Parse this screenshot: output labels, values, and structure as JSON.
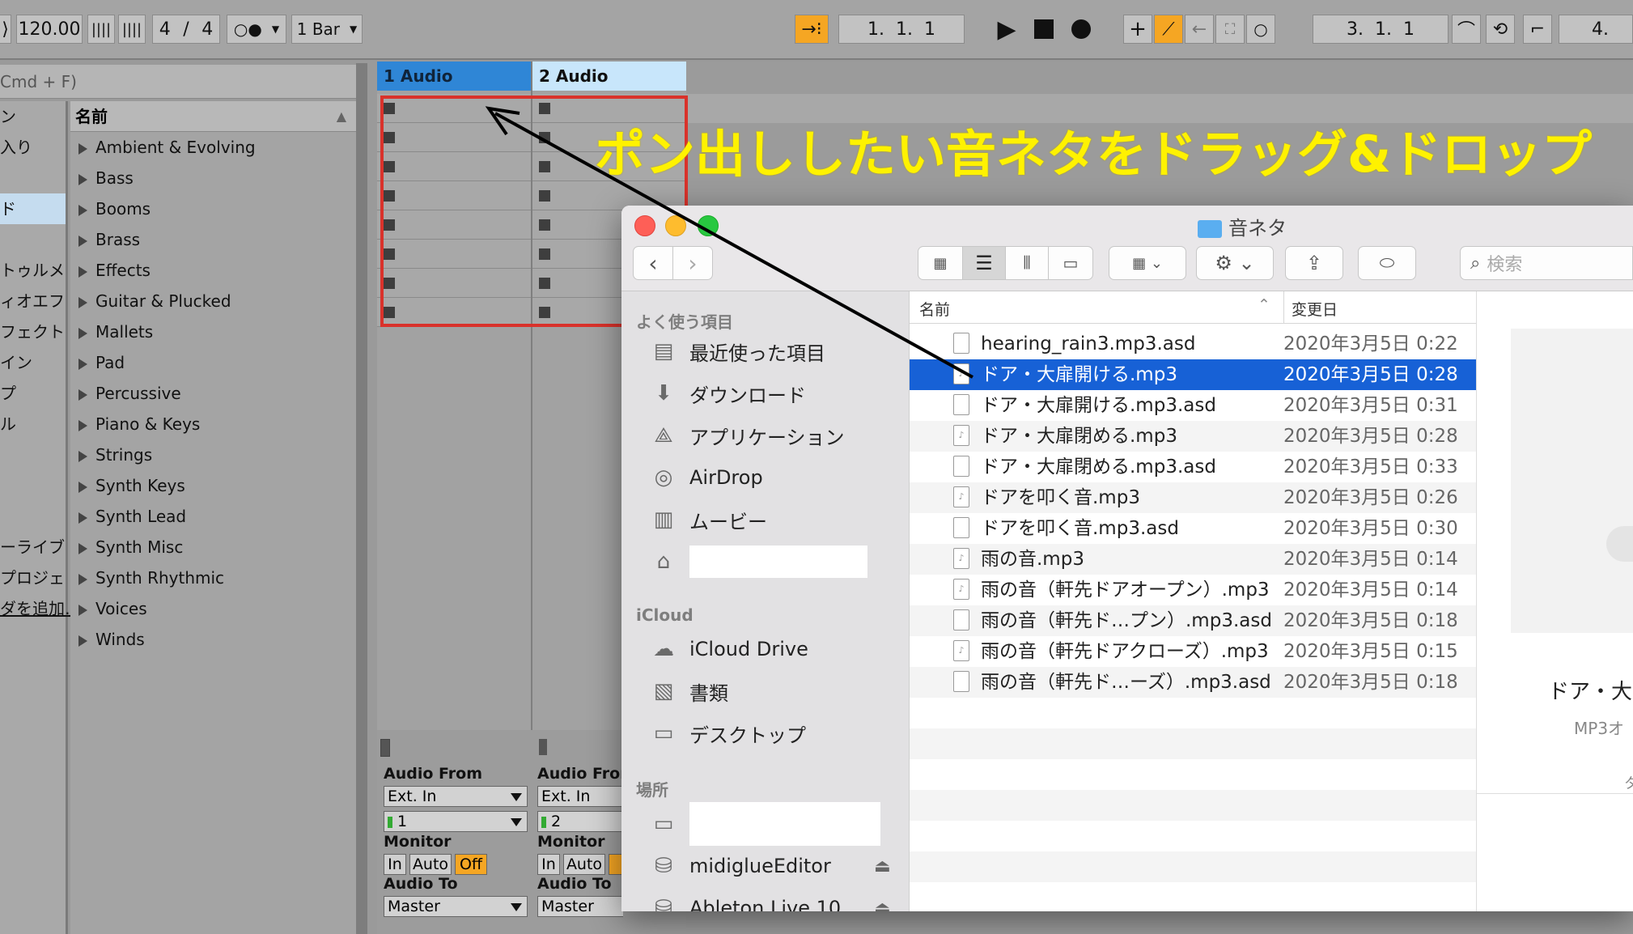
{
  "transport": {
    "tempo": "120.00",
    "time_sig_num": "4",
    "time_sig_sep": "/",
    "time_sig_den": "4",
    "quantize": "1 Bar",
    "metro": "○●",
    "arrangement_position": "1.  1.  1",
    "loop_start": "3.  1.  1",
    "loop_end_partial": "4."
  },
  "browser": {
    "search_hint": "Cmd + F)",
    "header": "名前",
    "places": [
      "ン",
      "入り",
      "",
      "ド",
      "",
      "トゥルメ",
      "ィオエフ",
      "フェクト",
      "イン",
      "プ",
      "ル",
      "",
      "",
      "",
      "ーライブ",
      "プロジェ",
      "ダを追加…"
    ],
    "categories": [
      "Ambient & Evolving",
      "Bass",
      "Booms",
      "Brass",
      "Effects",
      "Guitar & Plucked",
      "Mallets",
      "Pad",
      "Percussive",
      "Piano & Keys",
      "Strings",
      "Synth Keys",
      "Synth Lead",
      "Synth Misc",
      "Synth Rhythmic",
      "Voices",
      "Winds"
    ]
  },
  "tracks": [
    {
      "name": "1 Audio",
      "audio_from": "Audio From",
      "input": "Ext. In",
      "channel": "1",
      "monitor": "Monitor",
      "mon_in": "In",
      "mon_auto": "Auto",
      "mon_off": "Off",
      "audio_to": "Audio To",
      "output": "Master"
    },
    {
      "name": "2 Audio",
      "audio_from": "Audio From",
      "input": "Ext. In",
      "channel": "2",
      "monitor": "Monitor",
      "mon_in": "In",
      "mon_auto": "Auto",
      "mon_off": "",
      "audio_to": "Audio To",
      "output": "Master"
    }
  ],
  "caption": "ポン出ししたい音ネタをドラッグ&ドロップ",
  "finder": {
    "title": "音ネタ",
    "search_placeholder": "検索",
    "sidebar": {
      "favorites_title": "よく使う項目",
      "favorites": [
        "最近使った項目",
        "ダウンロード",
        "アプリケーション",
        "AirDrop",
        "ムービー",
        ""
      ],
      "icloud_title": "iCloud",
      "icloud": [
        "iCloud Drive",
        "書類",
        "デスクトップ"
      ],
      "locations_title": "場所",
      "locations": [
        "",
        "midiglueEditor",
        "Ableton Live 10"
      ]
    },
    "columns": {
      "name": "名前",
      "date": "変更日"
    },
    "files": [
      {
        "name": "hearing_rain3.mp3.asd",
        "date": "2020年3月5日 0:22"
      },
      {
        "name": "ドア・大扉開ける.mp3",
        "date": "2020年3月5日 0:28"
      },
      {
        "name": "ドア・大扉開ける.mp3.asd",
        "date": "2020年3月5日 0:31"
      },
      {
        "name": "ドア・大扉閉める.mp3",
        "date": "2020年3月5日 0:28"
      },
      {
        "name": "ドア・大扉閉める.mp3.asd",
        "date": "2020年3月5日 0:33"
      },
      {
        "name": "ドアを叩く音.mp3",
        "date": "2020年3月5日 0:26"
      },
      {
        "name": "ドアを叩く音.mp3.asd",
        "date": "2020年3月5日 0:30"
      },
      {
        "name": "雨の音.mp3",
        "date": "2020年3月5日 0:14"
      },
      {
        "name": "雨の音（軒先ドアオープン）.mp3",
        "date": "2020年3月5日 0:14"
      },
      {
        "name": "雨の音（軒先ド…プン）.mp3.asd",
        "date": "2020年3月5日 0:18"
      },
      {
        "name": "雨の音（軒先ドアクローズ）.mp3",
        "date": "2020年3月5日 0:15"
      },
      {
        "name": "雨の音（軒先ド…ーズ）.mp3.asd",
        "date": "2020年3月5日 0:18"
      }
    ],
    "preview_title": "ドア・大",
    "preview_kind": "MP3オ",
    "preview_extra": "タ"
  },
  "colors": {
    "track1": "#2f86d6",
    "track2": "#c8e6fb",
    "selection": "#1761d6",
    "caption": "#fff200",
    "drop_box": "#d9322b",
    "accent_orange": "#f5a623"
  }
}
